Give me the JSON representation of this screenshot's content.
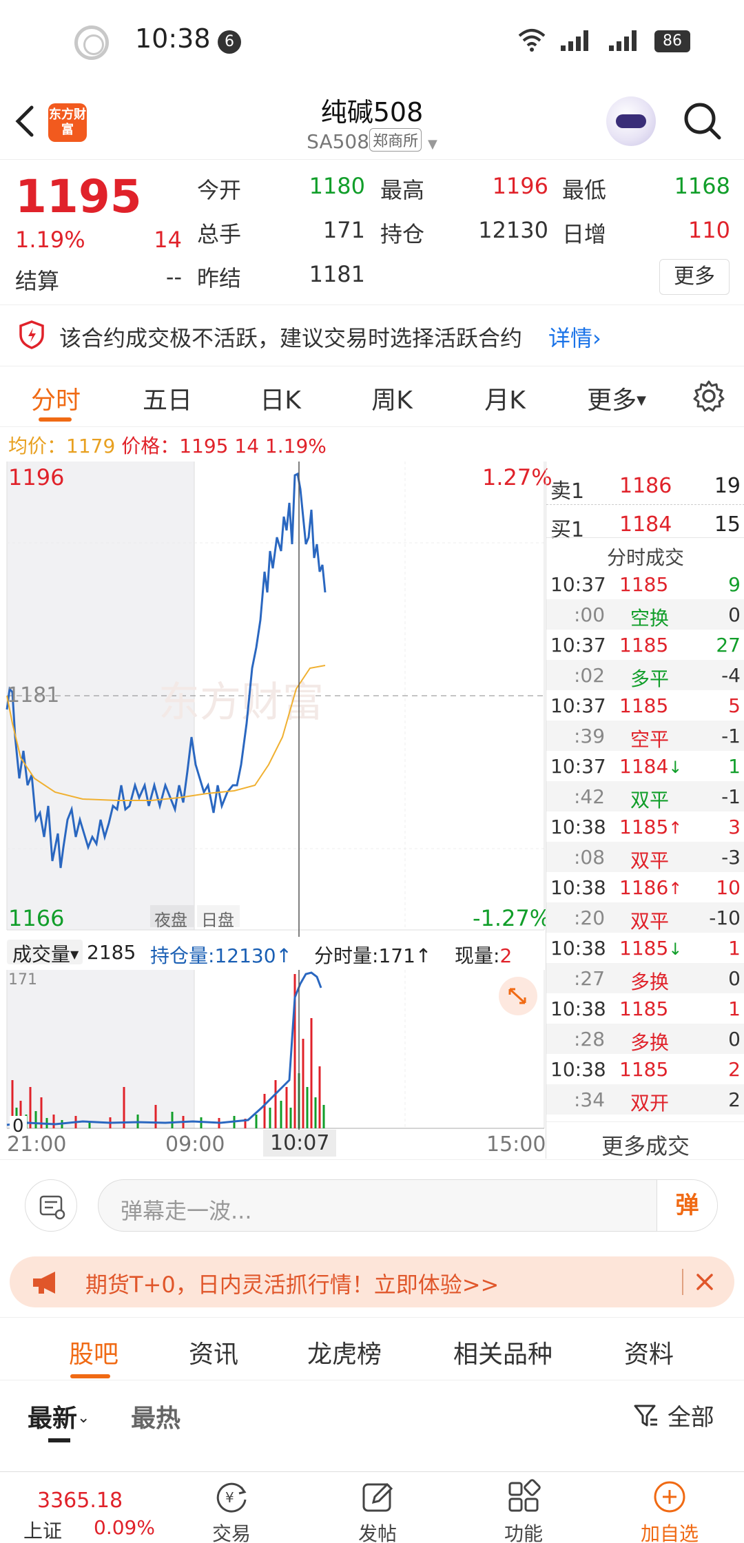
{
  "status_bar": {
    "time": "10:38",
    "notification_count": "6",
    "battery": "86"
  },
  "header": {
    "title": "纯碱508",
    "code": "SA508",
    "exchange": "郑商所",
    "logo_text": "东方财富"
  },
  "quote": {
    "price": "1195",
    "change_pct": "1.19%",
    "change_abs": "14",
    "settle_label": "结算",
    "settle_value": "--",
    "fields": [
      {
        "label": "今开",
        "value": "1180",
        "color": "green"
      },
      {
        "label": "最高",
        "value": "1196",
        "color": "red"
      },
      {
        "label": "最低",
        "value": "1168",
        "color": "green"
      },
      {
        "label": "总手",
        "value": "171",
        "color": "dark"
      },
      {
        "label": "持仓",
        "value": "12130",
        "color": "dark"
      },
      {
        "label": "日增",
        "value": "110",
        "color": "red"
      },
      {
        "label": "昨结",
        "value": "1181",
        "color": "dark"
      }
    ],
    "more_label": "更多"
  },
  "warning": {
    "text": "该合约成交极不活跃，建议交易时选择活跃合约",
    "detail_link": "详情›"
  },
  "chart_tabs": [
    "分时",
    "五日",
    "日K",
    "周K",
    "月K",
    "更多"
  ],
  "info_line": {
    "avg_label": "均价：",
    "avg_value": "1179",
    "price_label": "价格：",
    "price_value": "1195",
    "change_abs": "14",
    "change_pct": "1.19%"
  },
  "main_chart": {
    "y_high": "1196",
    "y_low": "1166",
    "y_ref": "1181",
    "pct_high": "1.27%",
    "pct_low": "-1.27%",
    "session_night": "夜盘",
    "session_day": "日盘",
    "watermark": "东方财富",
    "colors": {
      "price": "#2a67c0",
      "avg": "#f0b030",
      "up": "#e0222a",
      "down": "#119e2a"
    }
  },
  "volume_bar": {
    "selector_label": "成交量",
    "value": "2185",
    "oi_label": "持仓量:",
    "oi_value": "12130",
    "oi_arrow": "↑",
    "tick_vol_label": "分时量:",
    "tick_vol_value": "171",
    "tick_vol_arrow": "↑",
    "cur_label": "现量:",
    "cur_value": "2"
  },
  "volume_chart": {
    "max_label": "171",
    "zero_label": "0"
  },
  "time_axis": [
    "21:00",
    "09:00",
    "10:07",
    "15:00"
  ],
  "order_book": {
    "ask": {
      "label": "卖1",
      "price": "1186",
      "qty": "19"
    },
    "bid": {
      "label": "买1",
      "price": "1184",
      "qty": "15"
    },
    "ticks_title": "分时成交",
    "ticks": [
      {
        "time": "10:37",
        "price": "1185",
        "arrow": "",
        "vol": "9",
        "sub": ":00",
        "type": "空换",
        "type_color": "green",
        "diff": "0",
        "vol_color": "green"
      },
      {
        "time": "10:37",
        "price": "1185",
        "arrow": "",
        "vol": "27",
        "sub": ":02",
        "type": "多平",
        "type_color": "green",
        "diff": "-4",
        "vol_color": "green"
      },
      {
        "time": "10:37",
        "price": "1185",
        "arrow": "",
        "vol": "5",
        "sub": ":39",
        "type": "空平",
        "type_color": "red",
        "diff": "-1",
        "vol_color": "red"
      },
      {
        "time": "10:37",
        "price": "1184",
        "arrow": "↓",
        "vol": "1",
        "sub": ":42",
        "type": "双平",
        "type_color": "green",
        "diff": "-1",
        "vol_color": "green"
      },
      {
        "time": "10:38",
        "price": "1185",
        "arrow": "↑",
        "vol": "3",
        "sub": ":08",
        "type": "双平",
        "type_color": "red",
        "diff": "-3",
        "vol_color": "red"
      },
      {
        "time": "10:38",
        "price": "1186",
        "arrow": "↑",
        "vol": "10",
        "sub": ":20",
        "type": "双平",
        "type_color": "red",
        "diff": "-10",
        "vol_color": "red"
      },
      {
        "time": "10:38",
        "price": "1185",
        "arrow": "↓",
        "vol": "1",
        "sub": ":27",
        "type": "多换",
        "type_color": "red",
        "diff": "0",
        "vol_color": "red"
      },
      {
        "time": "10:38",
        "price": "1185",
        "arrow": "",
        "vol": "1",
        "sub": ":28",
        "type": "多换",
        "type_color": "red",
        "diff": "0",
        "vol_color": "red"
      },
      {
        "time": "10:38",
        "price": "1185",
        "arrow": "",
        "vol": "2",
        "sub": ":34",
        "type": "双开",
        "type_color": "red",
        "diff": "2",
        "vol_color": "red"
      }
    ],
    "more_label": "更多成交"
  },
  "comment": {
    "placeholder": "弹幕走一波...",
    "danmu_label": "弹"
  },
  "promo": {
    "text": "期货T+0，日内灵活抓行情！立即体验>>"
  },
  "forum_tabs": [
    "股吧",
    "资讯",
    "龙虎榜",
    "相关品种",
    "资料"
  ],
  "sort": {
    "newest": "最新",
    "hottest": "最热",
    "filter": "全部"
  },
  "bottom_nav": {
    "index_value": "3365.18",
    "index_name": "上证",
    "index_pct": "0.09%",
    "items": [
      "交易",
      "发帖",
      "功能",
      "加自选"
    ]
  }
}
